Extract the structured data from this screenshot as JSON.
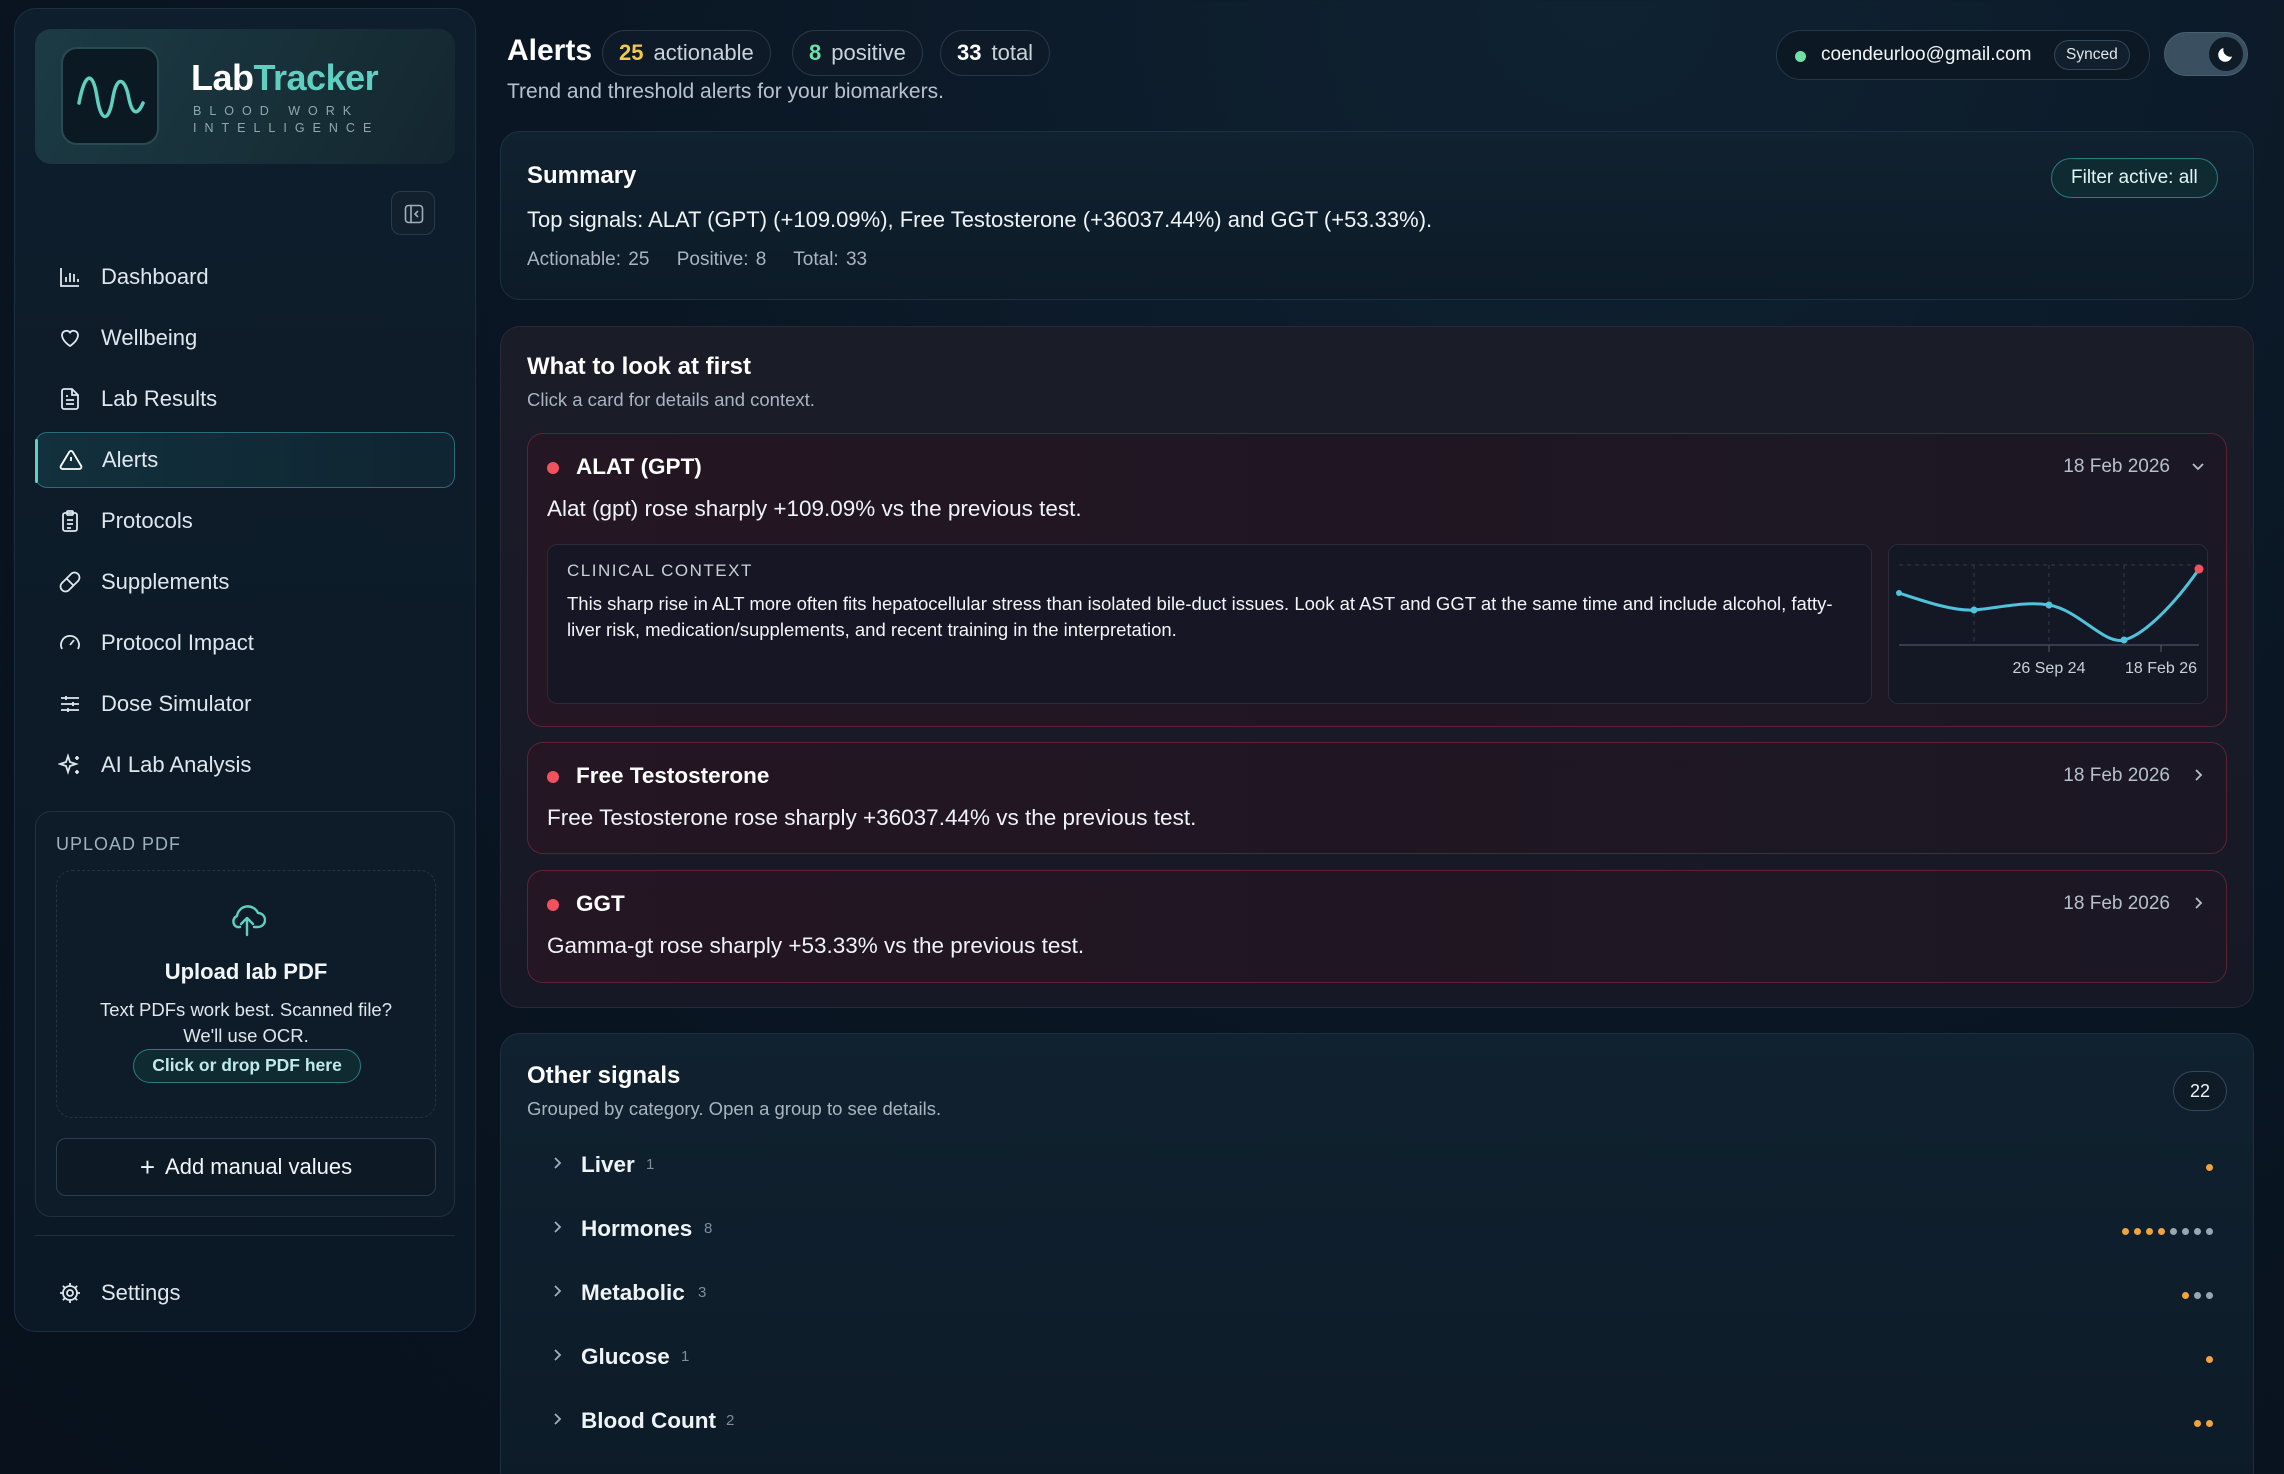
{
  "brand": {
    "name_part1": "Lab",
    "name_part2": "Tracker",
    "tagline": "BLOOD WORK INTELLIGENCE",
    "accent_color": "#5fd0c0"
  },
  "sidebar": {
    "collapse_icon": "sidebar-collapse-icon",
    "items": [
      {
        "label": "Dashboard",
        "icon": "bar-chart-icon"
      },
      {
        "label": "Wellbeing",
        "icon": "heart-icon"
      },
      {
        "label": "Lab Results",
        "icon": "file-text-icon"
      },
      {
        "label": "Alerts",
        "icon": "alert-triangle-icon",
        "active": true
      },
      {
        "label": "Protocols",
        "icon": "clipboard-icon"
      },
      {
        "label": "Supplements",
        "icon": "pill-icon"
      },
      {
        "label": "Protocol Impact",
        "icon": "gauge-icon"
      },
      {
        "label": "Dose Simulator",
        "icon": "sliders-icon"
      },
      {
        "label": "AI Lab Analysis",
        "icon": "sparkles-icon"
      }
    ],
    "upload": {
      "section_title": "UPLOAD PDF",
      "title": "Upload lab PDF",
      "text": "Text PDFs work best. Scanned file? We'll use OCR.",
      "button": "Click or drop PDF here",
      "manual_button": "Add manual values"
    },
    "settings_label": "Settings"
  },
  "header": {
    "title": "Alerts",
    "subtitle": "Trend and threshold alerts for your biomarkers.",
    "pills": [
      {
        "count": "25",
        "label": "actionable",
        "color": "#f4c84a"
      },
      {
        "count": "8",
        "label": "positive",
        "color": "#6ee0a8"
      },
      {
        "count": "33",
        "label": "total",
        "color": "#ffffff"
      }
    ],
    "account_email": "coendeurloo@gmail.com",
    "sync_status": "Synced",
    "theme_icon": "moon-icon"
  },
  "summary": {
    "title": "Summary",
    "filter_badge": "Filter active: all",
    "text": "Top signals: ALAT (GPT) (+109.09%), Free Testosterone (+36037.44%) and GGT (+53.33%).",
    "actionable": "Actionable: 25",
    "positive": "Positive: 8",
    "total": "Total: 33"
  },
  "look_first": {
    "title": "What to look at first",
    "subtitle": "Click a card for details and context.",
    "alerts": [
      {
        "name": "ALAT (GPT)",
        "date": "18 Feb 2026",
        "description": "Alat (gpt) rose sharply +109.09% vs the previous test.",
        "expanded": true,
        "context_label": "CLINICAL CONTEXT",
        "context_text": "This sharp rise in ALT more often fits hepatocellular stress than isolated bile-duct issues. Look at AST and GGT at the same time and include alcohol, fatty-liver risk, medication/supplements, and recent training in the interpretation.",
        "spark_labels": [
          "26 Sep 24",
          "18 Feb 26"
        ]
      },
      {
        "name": "Free Testosterone",
        "date": "18 Feb 2026",
        "description": "Free Testosterone rose sharply +36037.44% vs the previous test.",
        "expanded": false
      },
      {
        "name": "GGT",
        "date": "18 Feb 2026",
        "description": "Gamma-gt rose sharply +53.33% vs the previous test.",
        "expanded": false
      }
    ]
  },
  "other_signals": {
    "title": "Other signals",
    "subtitle": "Grouped by category. Open a group to see details.",
    "count": "22",
    "groups": [
      {
        "name": "Liver",
        "count": "1",
        "dots": [
          "orange"
        ]
      },
      {
        "name": "Hormones",
        "count": "8",
        "dots": [
          "orange",
          "orange",
          "orange",
          "orange",
          "gray",
          "gray",
          "gray",
          "gray"
        ]
      },
      {
        "name": "Metabolic",
        "count": "3",
        "dots": [
          "orange",
          "gray",
          "gray"
        ]
      },
      {
        "name": "Glucose",
        "count": "1",
        "dots": [
          "orange"
        ]
      },
      {
        "name": "Blood Count",
        "count": "2",
        "dots": [
          "orange",
          "orange"
        ]
      }
    ]
  }
}
